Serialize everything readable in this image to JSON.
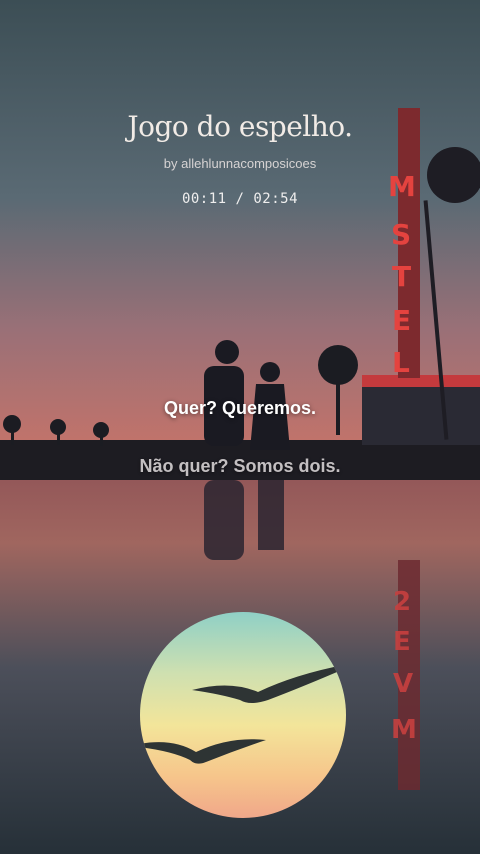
{
  "song": {
    "title": "Jogo do espelho.",
    "artist": "by allehlunnacomposicoes",
    "time": "00:11 / 02:54"
  },
  "lyrics": {
    "current": "Quer? Queremos.",
    "next": "Não quer? Somos dois."
  },
  "background": {
    "sign_text": "MSTEL",
    "reflected_sign_text": "2EVM",
    "colors": {
      "sky_top": "#3c5257",
      "sky_bottom": "#c0736b",
      "water": "#2f3a42",
      "neon": "#e4433f"
    }
  },
  "icons": {
    "artwork": "seagulls-sunset-artwork"
  }
}
